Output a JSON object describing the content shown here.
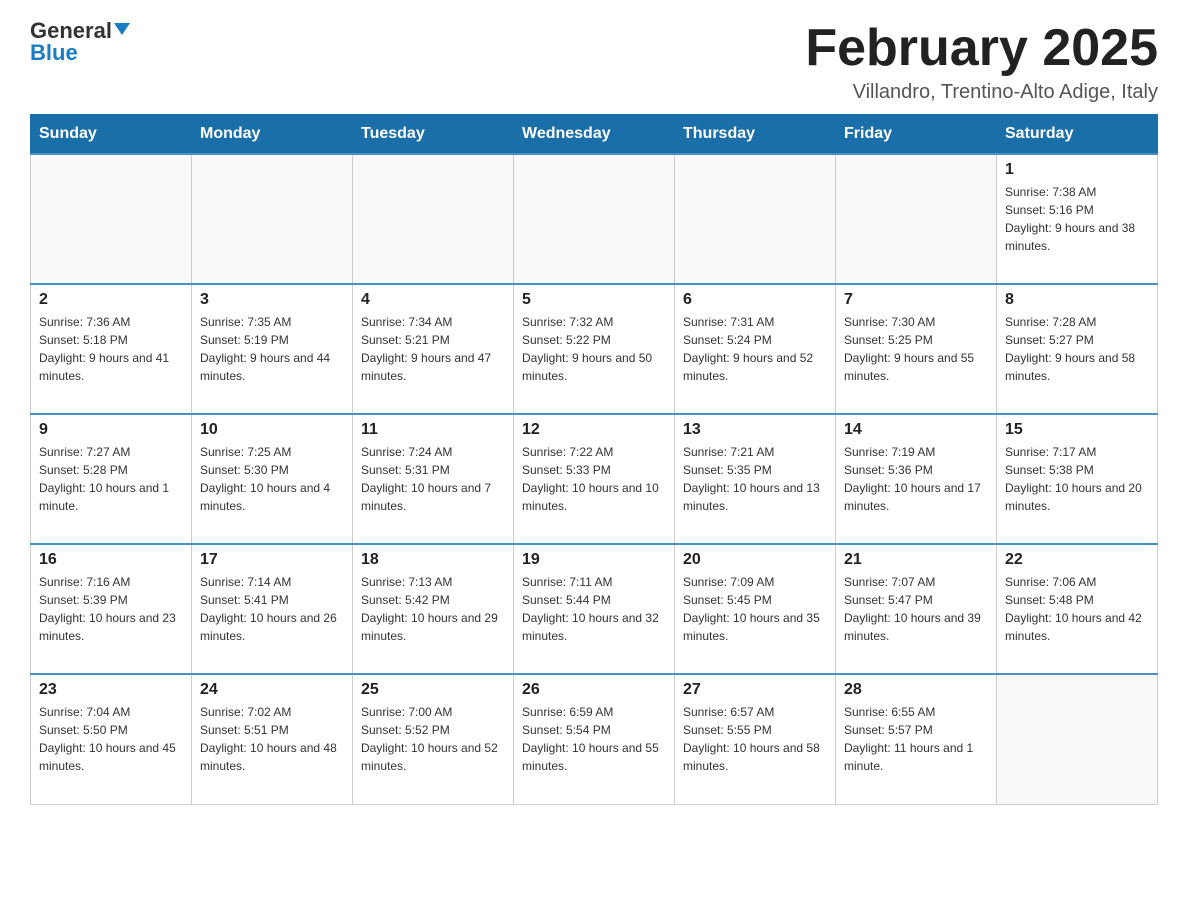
{
  "header": {
    "logo_general": "General",
    "logo_blue": "Blue",
    "month_title": "February 2025",
    "location": "Villandro, Trentino-Alto Adige, Italy"
  },
  "days_of_week": [
    "Sunday",
    "Monday",
    "Tuesday",
    "Wednesday",
    "Thursday",
    "Friday",
    "Saturday"
  ],
  "weeks": [
    [
      {
        "day": "",
        "info": ""
      },
      {
        "day": "",
        "info": ""
      },
      {
        "day": "",
        "info": ""
      },
      {
        "day": "",
        "info": ""
      },
      {
        "day": "",
        "info": ""
      },
      {
        "day": "",
        "info": ""
      },
      {
        "day": "1",
        "info": "Sunrise: 7:38 AM\nSunset: 5:16 PM\nDaylight: 9 hours and 38 minutes."
      }
    ],
    [
      {
        "day": "2",
        "info": "Sunrise: 7:36 AM\nSunset: 5:18 PM\nDaylight: 9 hours and 41 minutes."
      },
      {
        "day": "3",
        "info": "Sunrise: 7:35 AM\nSunset: 5:19 PM\nDaylight: 9 hours and 44 minutes."
      },
      {
        "day": "4",
        "info": "Sunrise: 7:34 AM\nSunset: 5:21 PM\nDaylight: 9 hours and 47 minutes."
      },
      {
        "day": "5",
        "info": "Sunrise: 7:32 AM\nSunset: 5:22 PM\nDaylight: 9 hours and 50 minutes."
      },
      {
        "day": "6",
        "info": "Sunrise: 7:31 AM\nSunset: 5:24 PM\nDaylight: 9 hours and 52 minutes."
      },
      {
        "day": "7",
        "info": "Sunrise: 7:30 AM\nSunset: 5:25 PM\nDaylight: 9 hours and 55 minutes."
      },
      {
        "day": "8",
        "info": "Sunrise: 7:28 AM\nSunset: 5:27 PM\nDaylight: 9 hours and 58 minutes."
      }
    ],
    [
      {
        "day": "9",
        "info": "Sunrise: 7:27 AM\nSunset: 5:28 PM\nDaylight: 10 hours and 1 minute."
      },
      {
        "day": "10",
        "info": "Sunrise: 7:25 AM\nSunset: 5:30 PM\nDaylight: 10 hours and 4 minutes."
      },
      {
        "day": "11",
        "info": "Sunrise: 7:24 AM\nSunset: 5:31 PM\nDaylight: 10 hours and 7 minutes."
      },
      {
        "day": "12",
        "info": "Sunrise: 7:22 AM\nSunset: 5:33 PM\nDaylight: 10 hours and 10 minutes."
      },
      {
        "day": "13",
        "info": "Sunrise: 7:21 AM\nSunset: 5:35 PM\nDaylight: 10 hours and 13 minutes."
      },
      {
        "day": "14",
        "info": "Sunrise: 7:19 AM\nSunset: 5:36 PM\nDaylight: 10 hours and 17 minutes."
      },
      {
        "day": "15",
        "info": "Sunrise: 7:17 AM\nSunset: 5:38 PM\nDaylight: 10 hours and 20 minutes."
      }
    ],
    [
      {
        "day": "16",
        "info": "Sunrise: 7:16 AM\nSunset: 5:39 PM\nDaylight: 10 hours and 23 minutes."
      },
      {
        "day": "17",
        "info": "Sunrise: 7:14 AM\nSunset: 5:41 PM\nDaylight: 10 hours and 26 minutes."
      },
      {
        "day": "18",
        "info": "Sunrise: 7:13 AM\nSunset: 5:42 PM\nDaylight: 10 hours and 29 minutes."
      },
      {
        "day": "19",
        "info": "Sunrise: 7:11 AM\nSunset: 5:44 PM\nDaylight: 10 hours and 32 minutes."
      },
      {
        "day": "20",
        "info": "Sunrise: 7:09 AM\nSunset: 5:45 PM\nDaylight: 10 hours and 35 minutes."
      },
      {
        "day": "21",
        "info": "Sunrise: 7:07 AM\nSunset: 5:47 PM\nDaylight: 10 hours and 39 minutes."
      },
      {
        "day": "22",
        "info": "Sunrise: 7:06 AM\nSunset: 5:48 PM\nDaylight: 10 hours and 42 minutes."
      }
    ],
    [
      {
        "day": "23",
        "info": "Sunrise: 7:04 AM\nSunset: 5:50 PM\nDaylight: 10 hours and 45 minutes."
      },
      {
        "day": "24",
        "info": "Sunrise: 7:02 AM\nSunset: 5:51 PM\nDaylight: 10 hours and 48 minutes."
      },
      {
        "day": "25",
        "info": "Sunrise: 7:00 AM\nSunset: 5:52 PM\nDaylight: 10 hours and 52 minutes."
      },
      {
        "day": "26",
        "info": "Sunrise: 6:59 AM\nSunset: 5:54 PM\nDaylight: 10 hours and 55 minutes."
      },
      {
        "day": "27",
        "info": "Sunrise: 6:57 AM\nSunset: 5:55 PM\nDaylight: 10 hours and 58 minutes."
      },
      {
        "day": "28",
        "info": "Sunrise: 6:55 AM\nSunset: 5:57 PM\nDaylight: 11 hours and 1 minute."
      },
      {
        "day": "",
        "info": ""
      }
    ]
  ]
}
